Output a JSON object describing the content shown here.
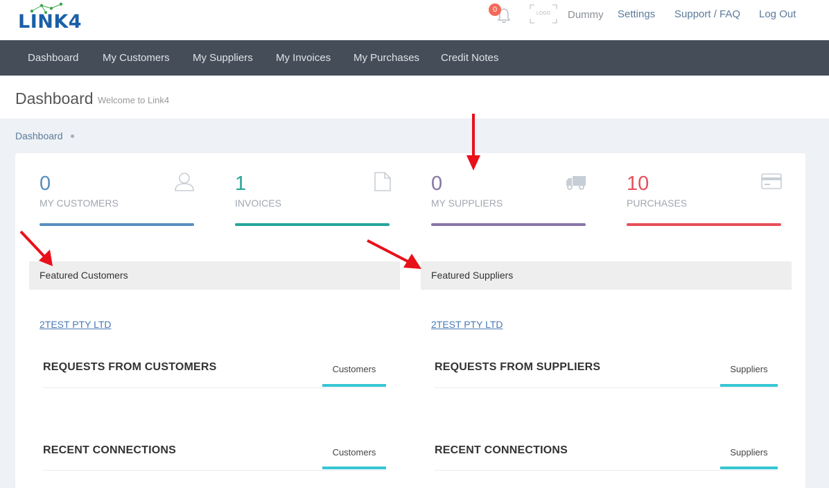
{
  "brand": {
    "name": "LINK4"
  },
  "header": {
    "notification_count": "0",
    "logo_placeholder": "LOGO",
    "user_name": "Dummy",
    "links": {
      "settings": "Settings",
      "support": "Support / FAQ",
      "logout": "Log Out"
    }
  },
  "nav": {
    "items": [
      "Dashboard",
      "My Customers",
      "My Suppliers",
      "My Invoices",
      "My Purchases",
      "Credit Notes"
    ]
  },
  "page": {
    "title": "Dashboard",
    "subtitle": "Welcome to Link4",
    "breadcrumb": "Dashboard"
  },
  "stats": [
    {
      "value": "0",
      "label": "MY CUSTOMERS",
      "color": "#578ebe",
      "icon": "user-icon"
    },
    {
      "value": "1",
      "label": "INVOICES",
      "color": "#26a69a",
      "icon": "document-icon"
    },
    {
      "value": "0",
      "label": "MY SUPPLIERS",
      "color": "#8775a7",
      "icon": "truck-icon"
    },
    {
      "value": "10",
      "label": "PURCHASES",
      "color": "#e7505a",
      "icon": "credit-card-icon"
    }
  ],
  "featured": {
    "customers": {
      "title": "Featured Customers",
      "item": "2TEST PTY LTD"
    },
    "suppliers": {
      "title": "Featured Suppliers",
      "item": "2TEST PTY LTD"
    }
  },
  "sections": {
    "requests_customers": {
      "title": "REQUESTS FROM CUSTOMERS",
      "tab": "Customers"
    },
    "requests_suppliers": {
      "title": "REQUESTS FROM SUPPLIERS",
      "tab": "Suppliers"
    },
    "recent_customers": {
      "title": "RECENT CONNECTIONS",
      "tab": "Customers"
    },
    "recent_suppliers": {
      "title": "RECENT CONNECTIONS",
      "tab": "Suppliers"
    }
  },
  "colors": {
    "accent_tab": "#36c6d3",
    "nav_bg": "#444d58",
    "annotation_arrow": "#e8101a"
  }
}
